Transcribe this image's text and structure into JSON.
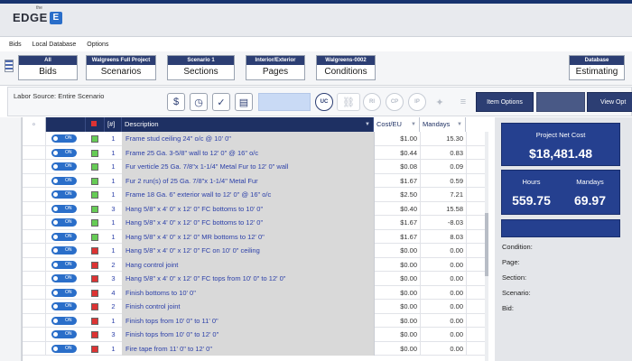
{
  "app": {
    "logo_small": "the",
    "logo_text": "EDGE",
    "logo_mark": "E"
  },
  "menu": [
    "Bids",
    "Local Database",
    "Options"
  ],
  "ribbon": [
    {
      "top": "All",
      "main": "Bids"
    },
    {
      "top": "Walgreens Full Project",
      "main": "Scenarios"
    },
    {
      "top": "Scenario 1",
      "main": "Sections"
    },
    {
      "top": "Interior/Exterior",
      "main": "Pages"
    },
    {
      "top": "Walgreens-0002",
      "main": "Conditions"
    },
    {
      "top": "Database",
      "main": "Estimating"
    }
  ],
  "toolbar": {
    "labor_source": "Labor Source:  Entire Scenario",
    "icons": [
      "$",
      "◷",
      "✓",
      "▤"
    ],
    "uc": "UC",
    "circles": [
      "RI",
      "CP",
      "IP"
    ],
    "item_options": "Item Options",
    "view_options": "View Opt"
  },
  "grid": {
    "header": {
      "check": "",
      "color": "",
      "num": "[#]",
      "desc": "Description",
      "cost": "Cost/EU",
      "mand": "Mandays"
    },
    "toggle_label": "ON",
    "rows": [
      {
        "color": "#66cc55",
        "num": "1",
        "desc": "Frame stud ceiling  24\" o/c @ 10' 0\"",
        "cost": "$1.00",
        "mand": "15.30"
      },
      {
        "color": "#66cc55",
        "num": "1",
        "desc": "Frame 25 Ga. 3-5/8\" wall to 12' 0\" @ 16\" o/c",
        "cost": "$0.44",
        "mand": "0.83"
      },
      {
        "color": "#66cc55",
        "num": "1",
        "desc": "Fur verticle 25 Ga. 7/8\"x 1-1/4\" Metal Fur to 12' 0\" wall",
        "cost": "$0.08",
        "mand": "0.09"
      },
      {
        "color": "#66cc55",
        "num": "1",
        "desc": "Fur 2 run(s) of 25 Ga. 7/8\"x 1-1/4\" Metal Fur",
        "cost": "$1.67",
        "mand": "0.59"
      },
      {
        "color": "#66cc55",
        "num": "1",
        "desc": "Frame 18 Ga. 6\" exterior wall to 12' 0\" @ 16\" o/c",
        "cost": "$2.50",
        "mand": "7.21"
      },
      {
        "color": "#66cc55",
        "num": "3",
        "desc": "Hang 5/8\" x 4' 0\" x 12' 0\" FC bottoms to 10' 0\"",
        "cost": "$0.40",
        "mand": "15.58"
      },
      {
        "color": "#66cc55",
        "num": "1",
        "desc": "Hang 5/8\" x 4' 0\" x 12' 0\" FC bottoms to 12' 0\"",
        "cost": "$1.67",
        "mand": "-8.03"
      },
      {
        "color": "#66cc55",
        "num": "1",
        "desc": "Hang 5/8\" x 4' 0\" x 12' 0\" MR bottoms to 12' 0\"",
        "cost": "$1.67",
        "mand": "8.03"
      },
      {
        "color": "#dd3333",
        "num": "1",
        "desc": "Hang 5/8\" x 4' 0\" x 12' 0\" FC on 10' 0\" ceiling",
        "cost": "$0.00",
        "mand": "0.00"
      },
      {
        "color": "#dd3333",
        "num": "2",
        "desc": "Hang control joint",
        "cost": "$0.00",
        "mand": "0.00"
      },
      {
        "color": "#dd3333",
        "num": "3",
        "desc": "Hang 5/8\" x 4' 0\" x 12' 0\" FC tops from 10' 0\" to 12' 0\"",
        "cost": "$0.00",
        "mand": "0.00"
      },
      {
        "color": "#dd3333",
        "num": "4",
        "desc": "Finish bottoms to 10' 0\"",
        "cost": "$0.00",
        "mand": "0.00"
      },
      {
        "color": "#dd3333",
        "num": "2",
        "desc": "Finish control joint",
        "cost": "$0.00",
        "mand": "0.00"
      },
      {
        "color": "#dd3333",
        "num": "1",
        "desc": "Finish tops from 10' 0\" to 11' 0\"",
        "cost": "$0.00",
        "mand": "0.00"
      },
      {
        "color": "#dd3333",
        "num": "3",
        "desc": "Finish tops from 10' 0\" to 12' 0\"",
        "cost": "$0.00",
        "mand": "0.00"
      },
      {
        "color": "#dd3333",
        "num": "1",
        "desc": "Fire tape from 11' 0\" to 12' 0\"",
        "cost": "$0.00",
        "mand": "0.00"
      }
    ]
  },
  "summary": {
    "net_cost_label": "Project Net Cost",
    "net_cost": "$18,481.48",
    "hours_label": "Hours",
    "hours": "559.75",
    "mandays_label": "Mandays",
    "mandays": "69.97",
    "info": [
      "Condition:",
      "Page:",
      "Section:",
      "Scenario:",
      "Bid:"
    ]
  }
}
